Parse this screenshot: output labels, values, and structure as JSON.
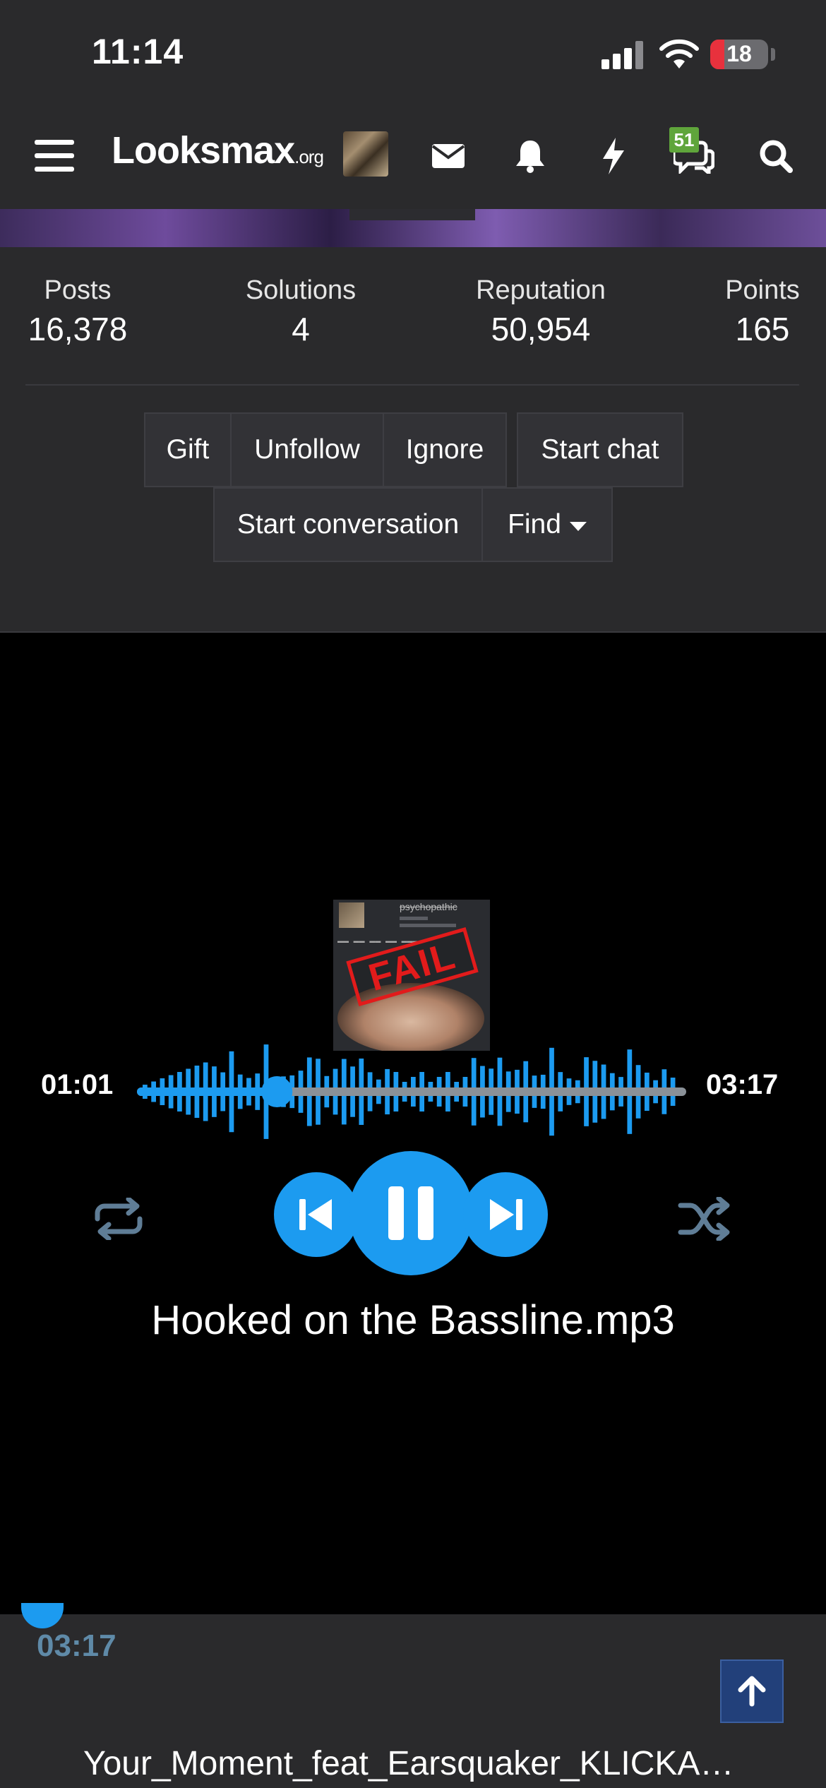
{
  "status_bar": {
    "time": "11:14",
    "battery": "18"
  },
  "nav": {
    "logo_main": "Looksmax",
    "logo_suffix": ".org",
    "chat_badge": "51"
  },
  "stats": [
    {
      "label": "Posts",
      "value": "16,378"
    },
    {
      "label": "Solutions",
      "value": "4"
    },
    {
      "label": "Reputation",
      "value": "50,954"
    },
    {
      "label": "Points",
      "value": "165"
    }
  ],
  "actions": {
    "gift": "Gift",
    "unfollow": "Unfollow",
    "ignore": "Ignore",
    "start_chat": "Start chat",
    "start_conversation": "Start conversation",
    "find": "Find"
  },
  "player": {
    "current_time": "01:01",
    "total_time": "03:17",
    "track_title": "Hooked on the Bassline.mp3",
    "progress": 0.31,
    "accent_color": "#1c9bf0",
    "cover": {
      "username": "psychopathic",
      "stamp": "FAIL"
    }
  },
  "next_track": {
    "time": "03:17",
    "title": "Your_Moment_feat_Earsquaker_KLICKA…"
  }
}
